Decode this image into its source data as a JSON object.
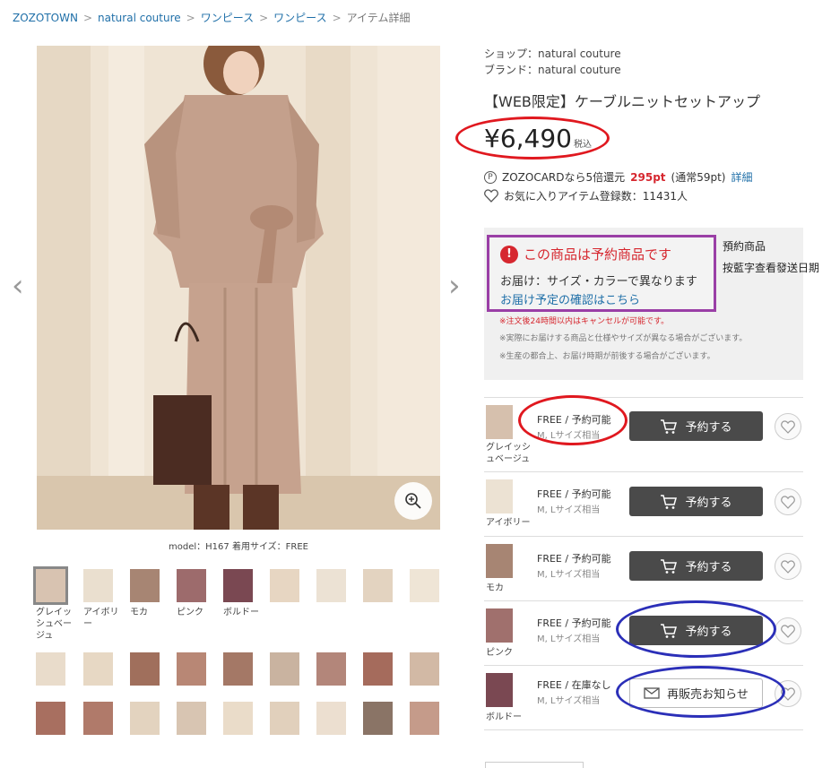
{
  "breadcrumb": {
    "items": [
      "ZOZOTOWN",
      "natural couture",
      "ワンピース",
      "ワンピース"
    ],
    "current": "アイテム詳細",
    "separator": ">"
  },
  "main_image": {
    "caption": "model：H167 着用サイズ：FREE"
  },
  "thumbnails": {
    "labels": [
      "グレイッシュベージュ",
      "アイボリー",
      "モカ",
      "ピンク",
      "ボルドー"
    ]
  },
  "product": {
    "shop": "ショップ：natural couture",
    "brand": "ブランド：natural couture",
    "title": "【WEB限定】ケーブルニットセットアップ",
    "price": "¥6,490",
    "tax": "税込",
    "point_prefix": "ZOZOCARDなら5倍還元",
    "point_value": "295pt",
    "point_suffix": "(通常59pt)",
    "point_link": "詳細",
    "favorite": "お気に入りアイテム登録数：11431人"
  },
  "reservation": {
    "heading": "この商品は予約商品です",
    "body": "お届け：サイズ・カラーで異なります",
    "link": "お届け予定の確認はこちら",
    "side_note_1": "預約商品",
    "side_note_2": "按藍字查看發送日期",
    "note_1": "※注文後24時間以内はキャンセルが可能です。",
    "note_2": "※実際にお届けする商品と仕様やサイズが異なる場合がございます。",
    "note_3": "※生産の都合上、お届け時期が前後する場合がございます。"
  },
  "variants": [
    {
      "color": "グレイッシュベージュ",
      "stock": "FREE / 予約可能",
      "size": "M, Lサイズ相当",
      "button": "予約する"
    },
    {
      "color": "アイボリー",
      "stock": "FREE / 予約可能",
      "size": "M, Lサイズ相当",
      "button": "予約する"
    },
    {
      "color": "モカ",
      "stock": "FREE / 予約可能",
      "size": "M, Lサイズ相当",
      "button": "予約する"
    },
    {
      "color": "ピンク",
      "stock": "FREE / 予約可能",
      "size": "M, Lサイズ相当",
      "button": "予約する"
    },
    {
      "color": "ボルドー",
      "stock": "FREE / 在庫なし",
      "size": "M, Lサイズ相当",
      "button": "再販売お知らせ"
    }
  ],
  "colors": {
    "link": "#1f6fa8",
    "price_oval": "#e0181f",
    "purple_box": "#9a3fa6",
    "blue_oval": "#2b2fb8",
    "button_dark": "#4a4a4a",
    "point_red": "#d6272f"
  }
}
